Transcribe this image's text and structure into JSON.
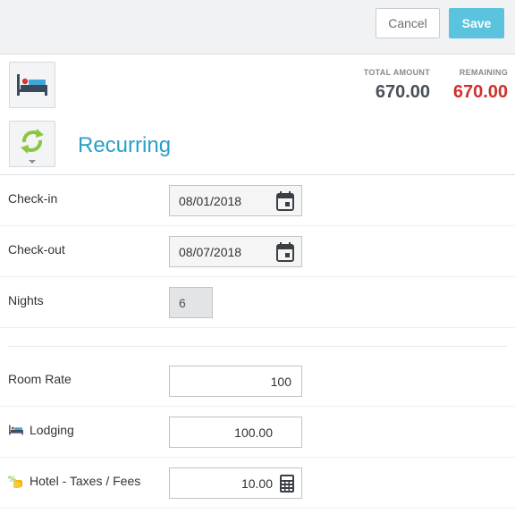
{
  "toolbar": {
    "cancel_label": "Cancel",
    "save_label": "Save"
  },
  "totals": {
    "total_label": "TOTAL AMOUNT",
    "total_value": "670.00",
    "remaining_label": "REMAINING",
    "remaining_value": "670.00",
    "remaining_color": "#d0312d"
  },
  "section": {
    "title": "Recurring",
    "title_color": "#2a9fc7",
    "bed_icon": "bed-icon",
    "recurring_icon": "recurring-arrows-icon"
  },
  "stay": {
    "checkin_label": "Check-in",
    "checkin_value": "08/01/2018",
    "checkout_label": "Check-out",
    "checkout_value": "08/07/2018",
    "nights_label": "Nights",
    "nights_value": "6"
  },
  "charges": {
    "room_rate_label": "Room Rate",
    "room_rate_value": "100",
    "lodging_label": "Lodging",
    "lodging_value": "100.00",
    "taxes_label": "Hotel - Taxes / Fees",
    "taxes_value": "10.00"
  },
  "accent_color": "#5bc3de"
}
